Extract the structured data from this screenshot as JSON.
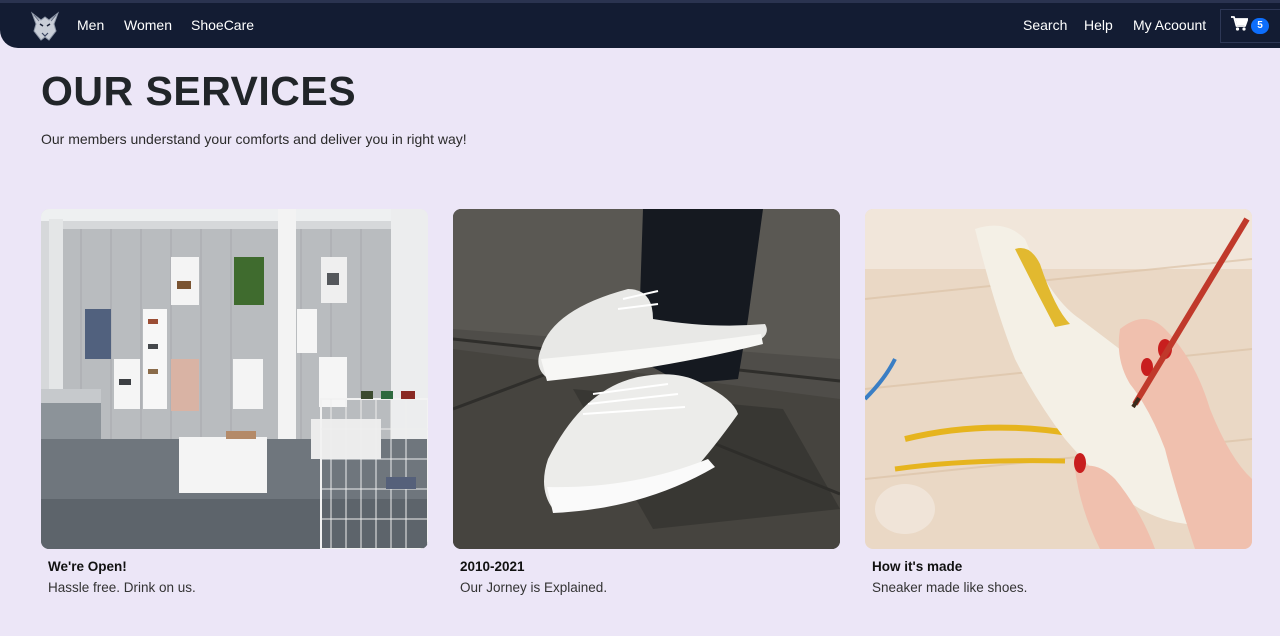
{
  "nav": {
    "links_left": [
      "Men",
      "Women",
      "ShoeCare"
    ],
    "search": "Search",
    "help": "Help",
    "account": "My Acoount",
    "cart_count": "5",
    "logo_icon": "wolf-logo-icon",
    "cart_icon": "shopping-cart-icon"
  },
  "header": {
    "title": "OUR SERVICES",
    "subtitle": "Our members understand your comforts and deliver you in right way!"
  },
  "cards": [
    {
      "title": "We're Open!",
      "text": "Hassle free. Drink on us.",
      "image": "shoe-store-interior"
    },
    {
      "title": "2010-2021",
      "text": "Our Jorney is Explained.",
      "image": "white-sneakers-on-pavement"
    },
    {
      "title": "How it's made",
      "text": "Sneaker made like shoes.",
      "image": "hand-sketching-on-heel-shoe"
    }
  ],
  "colors": {
    "navbar": "#131c33",
    "page_background": "#ece6f7",
    "badge": "#0d6efd"
  }
}
